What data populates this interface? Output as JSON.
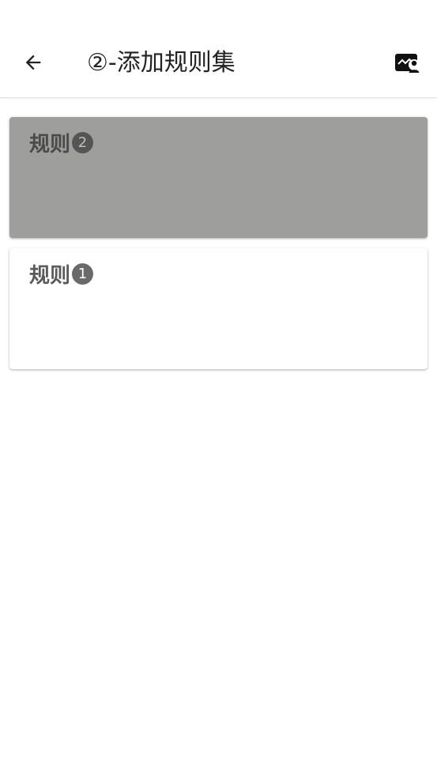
{
  "app_bar": {
    "title": "②-添加规则集",
    "back_icon": "arrow-left-icon",
    "action_icon": "image-person-icon"
  },
  "rules": [
    {
      "label": "规则",
      "number": "2",
      "selected": true
    },
    {
      "label": "规则",
      "number": "1",
      "selected": false
    }
  ],
  "colors": {
    "selected_card": "#9e9e9d",
    "card": "#ffffff",
    "text": "#222222"
  }
}
